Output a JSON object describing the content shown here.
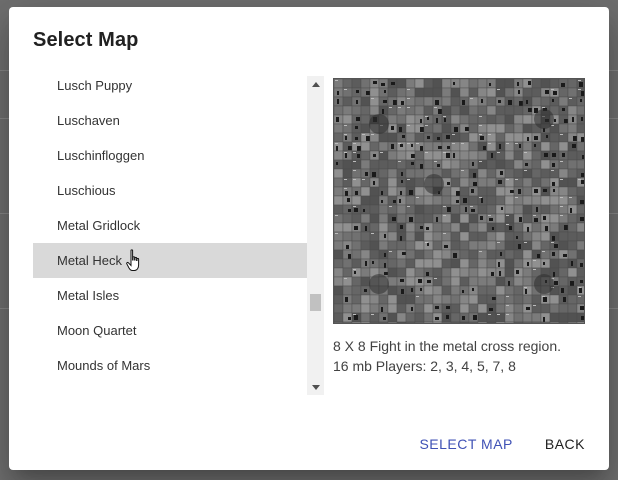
{
  "dialog": {
    "title": "Select Map",
    "maps": [
      {
        "name": "Lusch Puppy",
        "selected": false
      },
      {
        "name": "Luschaven",
        "selected": false
      },
      {
        "name": "Luschinfloggen",
        "selected": false
      },
      {
        "name": "Luschious",
        "selected": false
      },
      {
        "name": "Metal Gridlock",
        "selected": false
      },
      {
        "name": "Metal Heck",
        "selected": true
      },
      {
        "name": "Metal Isles",
        "selected": false
      },
      {
        "name": "Moon Quartet",
        "selected": false
      },
      {
        "name": "Mounds of Mars",
        "selected": false
      }
    ],
    "preview": {
      "description_line1": "8 X 8 Fight in the metal cross region.",
      "description_line2": "16 mb Players: 2, 3, 4, 5, 7, 8"
    },
    "actions": {
      "select_label": "SELECT MAP",
      "back_label": "BACK"
    }
  },
  "colors": {
    "accent": "#3f51b5",
    "selected_row": "#d9d9d9",
    "overlay": "#6f6f6f"
  }
}
